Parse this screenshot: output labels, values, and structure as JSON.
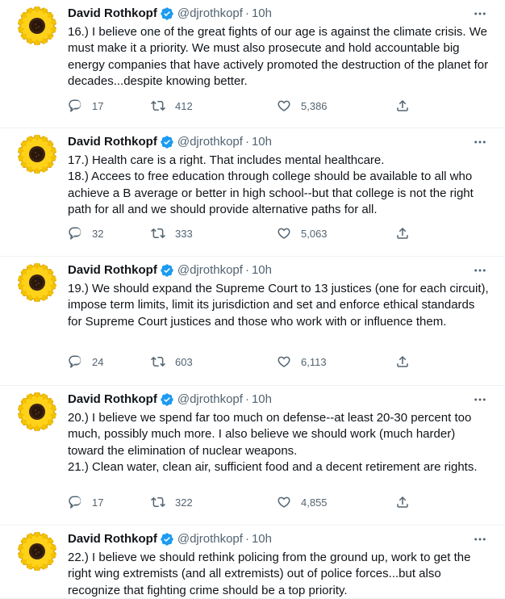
{
  "colors": {
    "verified": "#1d9bf0",
    "text": "#0f1419",
    "secondary": "#536471",
    "divider": "#eff3f4"
  },
  "tweets": [
    {
      "name": "David Rothkopf",
      "handle": "@djrothkopf",
      "separator": "·",
      "time": "10h",
      "paragraphs": [
        "16.) I believe one of the great fights of our age is against the climate crisis. We must make it a priority. We must also prosecute and hold accountable big energy companies that have actively promoted the destruction of the planet for decades...despite knowing better."
      ],
      "replies": "17",
      "retweets": "412",
      "likes": "5,386"
    },
    {
      "name": "David Rothkopf",
      "handle": "@djrothkopf",
      "separator": "·",
      "time": "10h",
      "paragraphs": [
        "17.) Health care is a right. That includes mental healthcare.",
        "18.) Accees to free education through college should be available to all who achieve a B average or better in high school--but that college is not the right path for all and we should provide alternative paths for all."
      ],
      "replies": "32",
      "retweets": "333",
      "likes": "5,063"
    },
    {
      "name": "David Rothkopf",
      "handle": "@djrothkopf",
      "separator": "·",
      "time": "10h",
      "paragraphs": [
        "19.) We should expand the Supreme Court to 13 justices (one for each circuit), impose term limits, limit its jurisdiction and set and enforce ethical standards for Supreme Court justices and those who work with or influence them."
      ],
      "replies": "24",
      "retweets": "603",
      "likes": "6,113"
    },
    {
      "name": "David Rothkopf",
      "handle": "@djrothkopf",
      "separator": "·",
      "time": "10h",
      "paragraphs": [
        "20.) I believe we spend far too much on defense--at least 20-30 percent too much, possibly much more. I also believe we should work (much harder) toward the elimination of nuclear weapons.",
        "21.) Clean water, clean air, sufficient food and a decent retirement are rights."
      ],
      "replies": "17",
      "retweets": "322",
      "likes": "4,855"
    },
    {
      "name": "David Rothkopf",
      "handle": "@djrothkopf",
      "separator": "·",
      "time": "10h",
      "paragraphs": [
        "22.) I believe we should rethink policing from the ground up, work to get the right wing extremists (and all extremists) out of police forces...but also recognize that fighting crime should be a top priority."
      ],
      "replies": "",
      "retweets": "",
      "likes": ""
    }
  ],
  "icons": {
    "avatar": "sunflower-avatar",
    "verified": "verified-badge-icon",
    "more": "more-options-icon",
    "reply": "reply-icon",
    "retweet": "retweet-icon",
    "like": "like-icon",
    "share": "share-icon"
  }
}
